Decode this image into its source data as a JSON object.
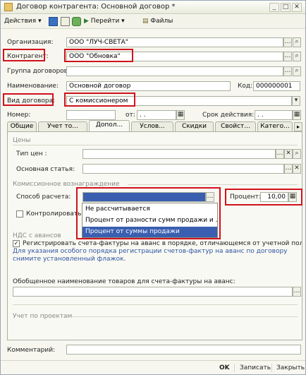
{
  "window": {
    "title": "Договор контрагента: Основной договор *"
  },
  "toolbar": {
    "actions": "Действия",
    "goto": "Перейти",
    "files": "Файлы"
  },
  "form": {
    "organization": {
      "label": "Организация:",
      "value": "ООО \"ЛУЧ-СВЕТА\""
    },
    "counterparty": {
      "label": "Контрагент:",
      "value": "ООО \"Обновка\""
    },
    "group": {
      "label": "Группа договоров:",
      "value": ""
    },
    "name": {
      "label": "Наименование:",
      "value": "Основной договор"
    },
    "code": {
      "label": "Код:",
      "value": "000000001"
    },
    "contract_type": {
      "label": "Вид договора:",
      "value": "С комиссионером"
    },
    "number": {
      "label": "Номер:",
      "value": ""
    },
    "from": {
      "label": "от:",
      "value": ". ."
    },
    "valid": {
      "label": "Срок действия:",
      "value": ". ."
    }
  },
  "tabs": [
    "Общие",
    "Учет то...",
    "Допол...",
    "Услов...",
    "Скидки",
    "Свойст...",
    "Катего..."
  ],
  "additional": {
    "prices_section": "Цены",
    "price_type_label": "Тип цен :",
    "main_article_label": "Основная статья:",
    "commission_section": "Комиссионное вознаграждение",
    "calc_method_label": "Способ расчета:",
    "percent_label": "Процент:",
    "percent_value": "10,00",
    "control_label": "Контролировать де",
    "dropdown_options": [
      "Не рассчитывается",
      "Процент от разности сумм продажи и ...",
      "Процент от суммы продажи"
    ],
    "vat_section": "НДС с авансов",
    "register_checkbox_label": "Регистрировать счета-фактуры на аванс в порядке, отличающемся от учетной политике",
    "register_checked_mark": "✓",
    "note": "Для указания особого порядка регистрации счетов-фактур на аванс по договору снимите установленный флажок.",
    "generalized_label": "Обобщенное наименование товаров для счета-фактуры на аванс:",
    "projects_section": "Учет по проектам"
  },
  "footer": {
    "comment_label": "Комментарий:",
    "ok": "OK",
    "save": "Записать",
    "close": "Закрыть"
  },
  "icons": {
    "select": "…",
    "clear": "✕",
    "search": "🔍",
    "calendar": "▦",
    "dropdown": "▾"
  },
  "colors": {
    "highlight": "#d0121b",
    "selection": "#3a5fb0",
    "link": "#2f55a4"
  }
}
